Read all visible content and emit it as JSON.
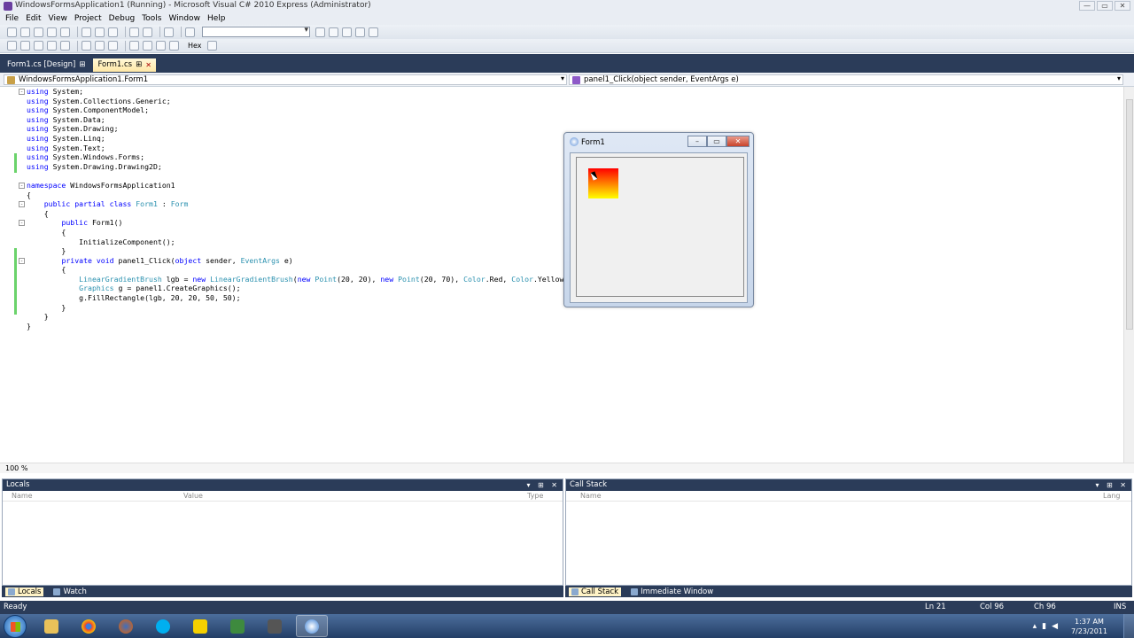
{
  "window": {
    "title": "WindowsFormsApplication1 (Running) - Microsoft Visual C# 2010 Express (Administrator)",
    "controls": [
      "—",
      "▭",
      "✕"
    ]
  },
  "menu": [
    "File",
    "Edit",
    "View",
    "Project",
    "Debug",
    "Tools",
    "Window",
    "Help"
  ],
  "toolbar": {
    "hex_label": "Hex",
    "combo_value": ""
  },
  "doc_tabs": [
    {
      "label": "Form1.cs [Design]",
      "pin": "⊞",
      "active": false
    },
    {
      "label": "Form1.cs",
      "pin": "⊞",
      "close": "✕",
      "active": true
    }
  ],
  "nav": {
    "type_combo": "WindowsFormsApplication1.Form1",
    "member_combo": "panel1_Click(object sender, EventArgs e)"
  },
  "code_lines": [
    {
      "fold": "-",
      "segments": [
        [
          "kw",
          "using"
        ],
        [
          "",
          " System;"
        ]
      ]
    },
    {
      "segments": [
        [
          "kw",
          "using"
        ],
        [
          "",
          " System.Collections.Generic;"
        ]
      ]
    },
    {
      "segments": [
        [
          "kw",
          "using"
        ],
        [
          "",
          " System.ComponentModel;"
        ]
      ]
    },
    {
      "segments": [
        [
          "kw",
          "using"
        ],
        [
          "",
          " System.Data;"
        ]
      ]
    },
    {
      "segments": [
        [
          "kw",
          "using"
        ],
        [
          "",
          " System.Drawing;"
        ]
      ]
    },
    {
      "segments": [
        [
          "kw",
          "using"
        ],
        [
          "",
          " System.Linq;"
        ]
      ]
    },
    {
      "segments": [
        [
          "kw",
          "using"
        ],
        [
          "",
          " System.Text;"
        ]
      ]
    },
    {
      "segments": [
        [
          "kw",
          "using"
        ],
        [
          "",
          " System.Windows.Forms;"
        ]
      ]
    },
    {
      "segments": [
        [
          "kw",
          "using"
        ],
        [
          "",
          " System.Drawing.Drawing2D;"
        ]
      ]
    },
    {
      "segments": [
        [
          "",
          ""
        ]
      ]
    },
    {
      "fold": "-",
      "segments": [
        [
          "kw",
          "namespace"
        ],
        [
          "",
          " WindowsFormsApplication1"
        ]
      ]
    },
    {
      "segments": [
        [
          "",
          "{"
        ]
      ]
    },
    {
      "fold": "-",
      "segments": [
        [
          "",
          "    "
        ],
        [
          "kw",
          "public partial class"
        ],
        [
          "",
          " "
        ],
        [
          "ty",
          "Form1"
        ],
        [
          "",
          " : "
        ],
        [
          "ty",
          "Form"
        ]
      ]
    },
    {
      "segments": [
        [
          "",
          "    {"
        ]
      ]
    },
    {
      "fold": "-",
      "segments": [
        [
          "",
          "        "
        ],
        [
          "kw",
          "public"
        ],
        [
          "",
          " Form1()"
        ]
      ]
    },
    {
      "segments": [
        [
          "",
          "        {"
        ]
      ]
    },
    {
      "segments": [
        [
          "",
          "            InitializeComponent();"
        ]
      ]
    },
    {
      "segments": [
        [
          "",
          "        }"
        ]
      ]
    },
    {
      "fold": "-",
      "segments": [
        [
          "",
          "        "
        ],
        [
          "kw",
          "private void"
        ],
        [
          "",
          " panel1_Click("
        ],
        [
          "kw",
          "object"
        ],
        [
          "",
          " sender, "
        ],
        [
          "ty",
          "EventArgs"
        ],
        [
          "",
          " e)"
        ]
      ]
    },
    {
      "segments": [
        [
          "",
          "        {"
        ]
      ]
    },
    {
      "segments": [
        [
          "",
          "            "
        ],
        [
          "ty",
          "LinearGradientBrush"
        ],
        [
          "",
          " lgb = "
        ],
        [
          "kw",
          "new"
        ],
        [
          "",
          " "
        ],
        [
          "ty",
          "LinearGradientBrush"
        ],
        [
          "",
          "("
        ],
        [
          "kw",
          "new"
        ],
        [
          "",
          " "
        ],
        [
          "ty",
          "Point"
        ],
        [
          "",
          "(20, 20), "
        ],
        [
          "kw",
          "new"
        ],
        [
          "",
          " "
        ],
        [
          "ty",
          "Point"
        ],
        [
          "",
          "(20, 70), "
        ],
        [
          "ty",
          "Color"
        ],
        [
          "",
          ".Red, "
        ],
        [
          "ty",
          "Color"
        ],
        [
          "",
          ".Yellow);"
        ]
      ]
    },
    {
      "segments": [
        [
          "",
          "            "
        ],
        [
          "ty",
          "Graphics"
        ],
        [
          "",
          " g = panel1.CreateGraphics();"
        ]
      ]
    },
    {
      "segments": [
        [
          "",
          "            g.FillRectangle(lgb, 20, 20, 50, 50);"
        ]
      ]
    },
    {
      "segments": [
        [
          "",
          "        }"
        ]
      ]
    },
    {
      "segments": [
        [
          "",
          "    }"
        ]
      ]
    },
    {
      "segments": [
        [
          "",
          "}"
        ]
      ]
    }
  ],
  "editor_status": {
    "zoom": "100 %"
  },
  "form1": {
    "title": "Form1",
    "gradient_colors": [
      "#ff0000",
      "#ffff00"
    ]
  },
  "locals": {
    "title": "Locals",
    "columns": [
      "Name",
      "Value",
      "Type"
    ],
    "header_controls": "▾ ⊞ ✕"
  },
  "callstack": {
    "title": "Call Stack",
    "columns": [
      "Name",
      "Lang"
    ],
    "header_controls": "▾ ⊞ ✕"
  },
  "bottom_tabs_left": [
    {
      "label": "Locals",
      "active": true
    },
    {
      "label": "Watch",
      "active": false
    }
  ],
  "bottom_tabs_right": [
    {
      "label": "Call Stack",
      "active": true
    },
    {
      "label": "Immediate Window",
      "active": false
    }
  ],
  "status": {
    "text": "Ready",
    "ln": "Ln 21",
    "col": "Col 96",
    "ch": "Ch 96",
    "mode": "INS"
  },
  "taskbar": {
    "apps": [
      "explorer-icon",
      "chrome-icon",
      "firefox-icon",
      "skype-icon",
      "aim-icon",
      "csharp-express-icon",
      "archive-icon",
      "vs-debug-icon"
    ],
    "time": "1:37 AM",
    "date": "7/23/2011"
  },
  "colors": {
    "accent_dark": "#2b3c59",
    "active_tab": "#ffe8a6",
    "keyword": "#0000ff",
    "type": "#2b91af",
    "changed_margin": "#6bd36b"
  }
}
